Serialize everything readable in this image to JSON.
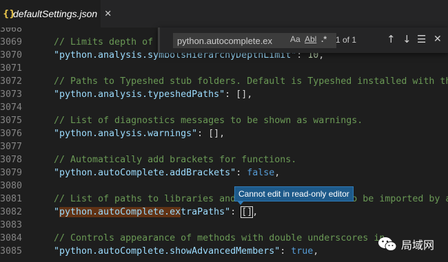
{
  "tab": {
    "icon": "{}",
    "title": "defaultSettings.json",
    "close": "✕"
  },
  "find": {
    "value": "python.autocomplete.ex",
    "match_case": "Aa",
    "whole_word": "Abl",
    "regex": ".*",
    "count": "1 of 1",
    "prev": "↑",
    "next": "↓",
    "selection": "☰",
    "close": "✕"
  },
  "tooltip": "Cannot edit in read-only editor",
  "lines": [
    {
      "num": "3068",
      "parts": []
    },
    {
      "num": "3069",
      "parts": [
        {
          "t": "// Limits depth of t",
          "c": "tok-comment"
        }
      ]
    },
    {
      "num": "3070",
      "parts": [
        {
          "t": "\"python.analysis.symbolsHierarchyDepthLimit\"",
          "c": "tok-key"
        },
        {
          "t": ": ",
          "c": "tok-punct"
        },
        {
          "t": "10",
          "c": "tok-num"
        },
        {
          "t": ",",
          "c": "tok-punct"
        }
      ]
    },
    {
      "num": "3071",
      "parts": []
    },
    {
      "num": "3072",
      "parts": [
        {
          "t": "// Paths to Typeshed stub folders. Default is Typeshed installed with the l",
          "c": "tok-comment"
        }
      ]
    },
    {
      "num": "3073",
      "parts": [
        {
          "t": "\"python.analysis.typeshedPaths\"",
          "c": "tok-key"
        },
        {
          "t": ": [],",
          "c": "tok-punct"
        }
      ]
    },
    {
      "num": "3074",
      "parts": []
    },
    {
      "num": "3075",
      "parts": [
        {
          "t": "// List of diagnostics messages to be shown as warnings.",
          "c": "tok-comment"
        }
      ]
    },
    {
      "num": "3076",
      "parts": [
        {
          "t": "\"python.analysis.warnings\"",
          "c": "tok-key"
        },
        {
          "t": ": [],",
          "c": "tok-punct"
        }
      ]
    },
    {
      "num": "3077",
      "parts": []
    },
    {
      "num": "3078",
      "parts": [
        {
          "t": "// Automatically add brackets for functions.",
          "c": "tok-comment"
        }
      ]
    },
    {
      "num": "3079",
      "parts": [
        {
          "t": "\"python.autoComplete.addBrackets\"",
          "c": "tok-key"
        },
        {
          "t": ": ",
          "c": "tok-punct"
        },
        {
          "t": "false",
          "c": "tok-kw"
        },
        {
          "t": ",",
          "c": "tok-punct"
        }
      ]
    },
    {
      "num": "3080",
      "parts": []
    },
    {
      "num": "3081",
      "parts": [
        {
          "t": "// List of paths to libraries and the like that need to be imported by auto",
          "c": "tok-comment"
        }
      ]
    },
    {
      "num": "3082",
      "parts": [
        {
          "t": "\"",
          "c": "tok-key"
        },
        {
          "t": "python.autoComplete.ex",
          "c": "tok-key hl-match"
        },
        {
          "t": "traPaths\"",
          "c": "tok-key"
        },
        {
          "t": ": ",
          "c": "tok-punct"
        },
        {
          "t": "[]",
          "c": "tok-punct cursor-box"
        },
        {
          "t": ",",
          "c": "tok-punct"
        }
      ]
    },
    {
      "num": "3083",
      "parts": []
    },
    {
      "num": "3084",
      "parts": [
        {
          "t": "// Controls appearance of methods with double underscores in",
          "c": "tok-comment"
        }
      ]
    },
    {
      "num": "3085",
      "parts": [
        {
          "t": "\"python.autoComplete.showAdvancedMembers\"",
          "c": "tok-key"
        },
        {
          "t": ": ",
          "c": "tok-punct"
        },
        {
          "t": "true",
          "c": "tok-kw"
        },
        {
          "t": ",",
          "c": "tok-punct"
        }
      ]
    }
  ],
  "watermark": {
    "text": "局域网"
  },
  "colors": {
    "background": "#1e1e1e",
    "comment": "#6a9955",
    "key": "#9cdcfe",
    "keyword": "#569cd6",
    "number": "#b5cea8",
    "match": "#613214",
    "tooltip": "#1e5a8a"
  }
}
